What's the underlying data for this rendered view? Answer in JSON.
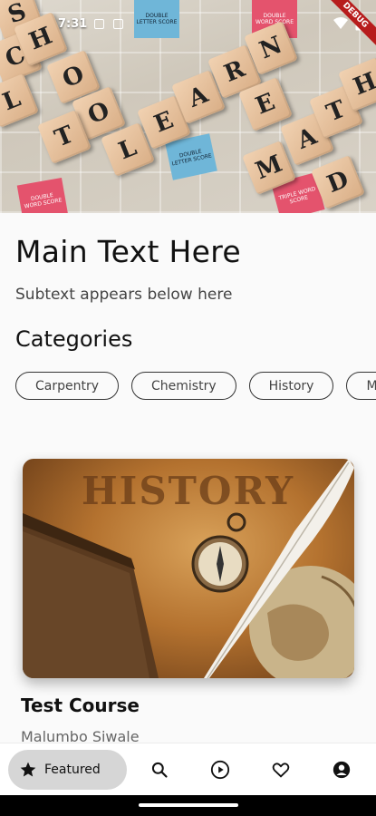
{
  "status_bar": {
    "time": "7:31",
    "debug_label": "DEBUG"
  },
  "hero": {
    "tiles": [
      "S",
      "C",
      "H",
      "O",
      "O",
      "L",
      "T",
      "L",
      "E",
      "A",
      "R",
      "N",
      "E",
      "D",
      "M",
      "A",
      "T",
      "H",
      "A"
    ],
    "squares": [
      "DOUBLE WORD SCORE",
      "DOUBLE LETTER SCORE",
      "TRIPLE WORD SCORE",
      "DOUBLE WORD SCORE"
    ]
  },
  "main": {
    "title": "Main Text Here",
    "subtext": "Subtext appears below here",
    "categories_heading": "Categories",
    "categories": [
      "Carpentry",
      "Chemistry",
      "History",
      "M"
    ]
  },
  "course": {
    "image_text": "HISTORY",
    "title": "Test Course",
    "author": "Malumbo Siwale"
  },
  "bottom_nav": {
    "featured_label": "Featured",
    "items": [
      "star-icon",
      "search-icon",
      "play-circle-icon",
      "heart-icon",
      "account-icon"
    ]
  },
  "colors": {
    "background": "#fafafa",
    "nav_active": "#d6d6d6",
    "debug_banner": "#b71c1c"
  }
}
